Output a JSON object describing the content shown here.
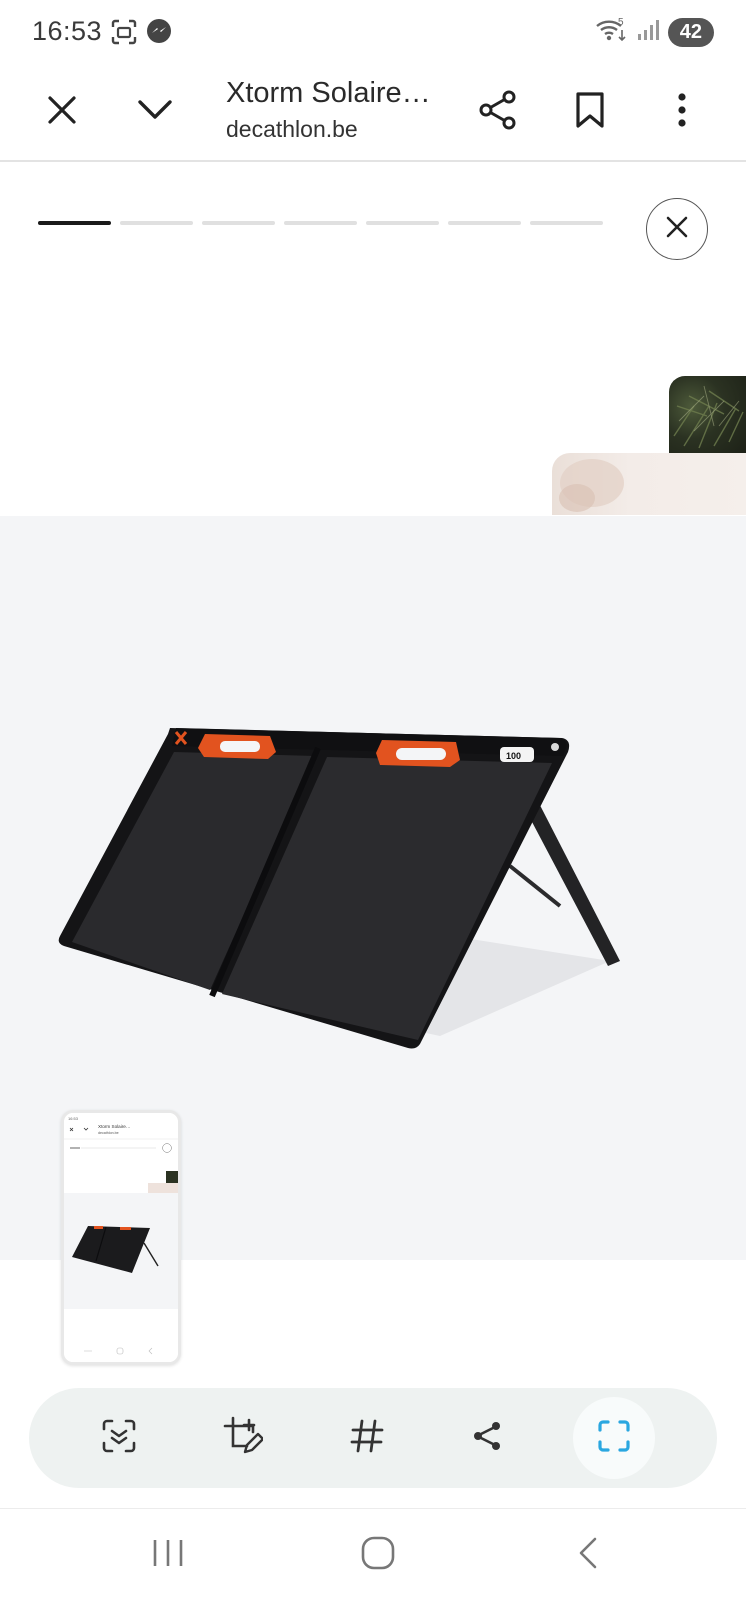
{
  "status_bar": {
    "time": "16:53",
    "icons_left": [
      "screenshot-icon",
      "messenger-icon"
    ],
    "icons_right": [
      "wifi-icon",
      "signal-icon"
    ],
    "battery": "42"
  },
  "app_bar": {
    "title": "Xtorm Solaire…",
    "subtitle": "decathlon.be",
    "icons": [
      "close-icon",
      "chevron-down-icon",
      "share-icon",
      "bookmark-icon",
      "more-vert-icon"
    ]
  },
  "story": {
    "segments_total": 7,
    "active_segment": 1
  },
  "product_image": {
    "description_icon": "solar-panel-image",
    "label_badge": "100"
  },
  "preview_thumbnail": {
    "title": "Xtorm Solaire…",
    "subtitle": "decathlon.be"
  },
  "toolbar": {
    "items": [
      "scan-text-icon",
      "edit-crop-icon",
      "hashtag-icon",
      "share-icon",
      "capture-scroll-icon"
    ]
  },
  "nav_bar": {
    "items": [
      "recents-icon",
      "home-icon",
      "back-icon"
    ]
  },
  "colors": {
    "accent_toolbar_icon": "#2aa7e0",
    "panel_orange": "#e2531f",
    "panel_black": "#1b1b1d"
  }
}
